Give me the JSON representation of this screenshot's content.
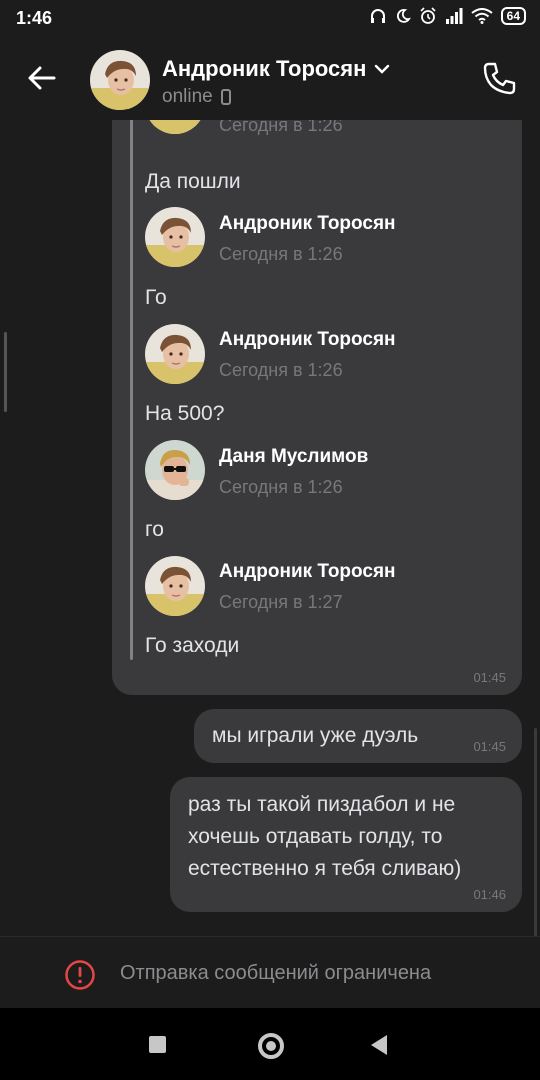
{
  "status_bar": {
    "time": "1:46",
    "battery": "64",
    "icons": [
      "headphones-icon",
      "moon-icon",
      "alarm-icon",
      "signal-icon",
      "wifi-icon",
      "battery-icon"
    ]
  },
  "header": {
    "name": "Андроник Торосян",
    "status": "online",
    "colors": {
      "background": "#1c1c1c",
      "status_text": "#8c8c8c"
    }
  },
  "forwarded": {
    "items": [
      {
        "author": "",
        "date": "Сегодня в 1:26",
        "text": "Да пошли",
        "avatar": "andronik"
      },
      {
        "author": "Андроник Торосян",
        "date": "Сегодня в 1:26",
        "text": "Го",
        "avatar": "andronik"
      },
      {
        "author": "Андроник Торосян",
        "date": "Сегодня в 1:26",
        "text": "На 500?",
        "avatar": "andronik"
      },
      {
        "author": "Даня Муслимов",
        "date": "Сегодня в 1:26",
        "text": "го",
        "avatar": "danya"
      },
      {
        "author": "Андроник Торосян",
        "date": "Сегодня в 1:27",
        "text": "Го заходи",
        "avatar": "andronik"
      }
    ],
    "time": "01:45"
  },
  "messages": [
    {
      "lines": [
        "мы играли уже дуэль"
      ],
      "time": "01:45"
    },
    {
      "lines": [
        "раз ты такой пиздабол и не",
        "хочешь отдавать голду, то",
        "естественно я тебя сливаю)"
      ],
      "time": "01:46"
    }
  ],
  "restriction": {
    "text": "Отправка сообщений ограничена",
    "icon_color": "#e64646"
  },
  "colors": {
    "bubble": "#3a3a3c",
    "app_background": "#1c1c1c",
    "secondary_text": "#76787b"
  }
}
